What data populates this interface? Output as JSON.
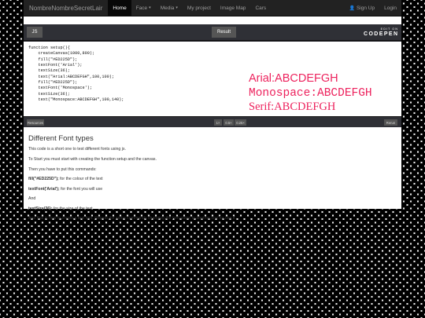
{
  "navbar": {
    "brand": "NombreNombreSecretLair",
    "items": [
      {
        "label": "Home",
        "caret": ""
      },
      {
        "label": "Face",
        "caret": "▾"
      },
      {
        "label": "Media",
        "caret": "▾"
      },
      {
        "label": "My project",
        "caret": ""
      },
      {
        "label": "Image Map",
        "caret": ""
      },
      {
        "label": "Cars",
        "caret": ""
      }
    ],
    "signup": "Sign Up",
    "login": "Login"
  },
  "pen": {
    "js_tab": "JS",
    "result_tab": "Result",
    "edit_on": "EDIT ON",
    "codepen": "CODEPEN",
    "code": "function setup(){\n    createCanvas(1000,800);\n    fill(\"#ED225D\");\n    textFont('Arial');\n    textSize(36);\n    text(\"Arial:ABCDEFGH\",100,100);\n    fill(\"#ED225D\");\n    textFont('Monospace');\n    textSize(36);\n    text(\"Monospace:ABCDEFGH\",100,140);",
    "result_lines": [
      "Arial:ABCDEFGH",
      "Monospace:ABCDEFGH",
      "Serif:ABCDEFGH"
    ],
    "resources": "Resources",
    "zoom": [
      "1×",
      "0.5×",
      "0.25×"
    ],
    "rerun": "Rerun"
  },
  "article": {
    "title": "Different Font types",
    "intro": "This code is a short one to test different fonts using js.",
    "start": "To Start you must start with creating the function setup and the canvas.",
    "then": "Then you have to put this commands:",
    "cmd1": "fill(\"#ED225D\");",
    "cmd1_desc": " for the colour of the text",
    "cmd2": "textFont('Arial');",
    "cmd2_desc": " for the font you will use",
    "and": "And",
    "cmd3": "textSize(36);",
    "cmd3_desc": " for the size of the text",
    "outro": "And that is how to create a text font. Repeat the same commands changing the font name to another one for use it."
  }
}
